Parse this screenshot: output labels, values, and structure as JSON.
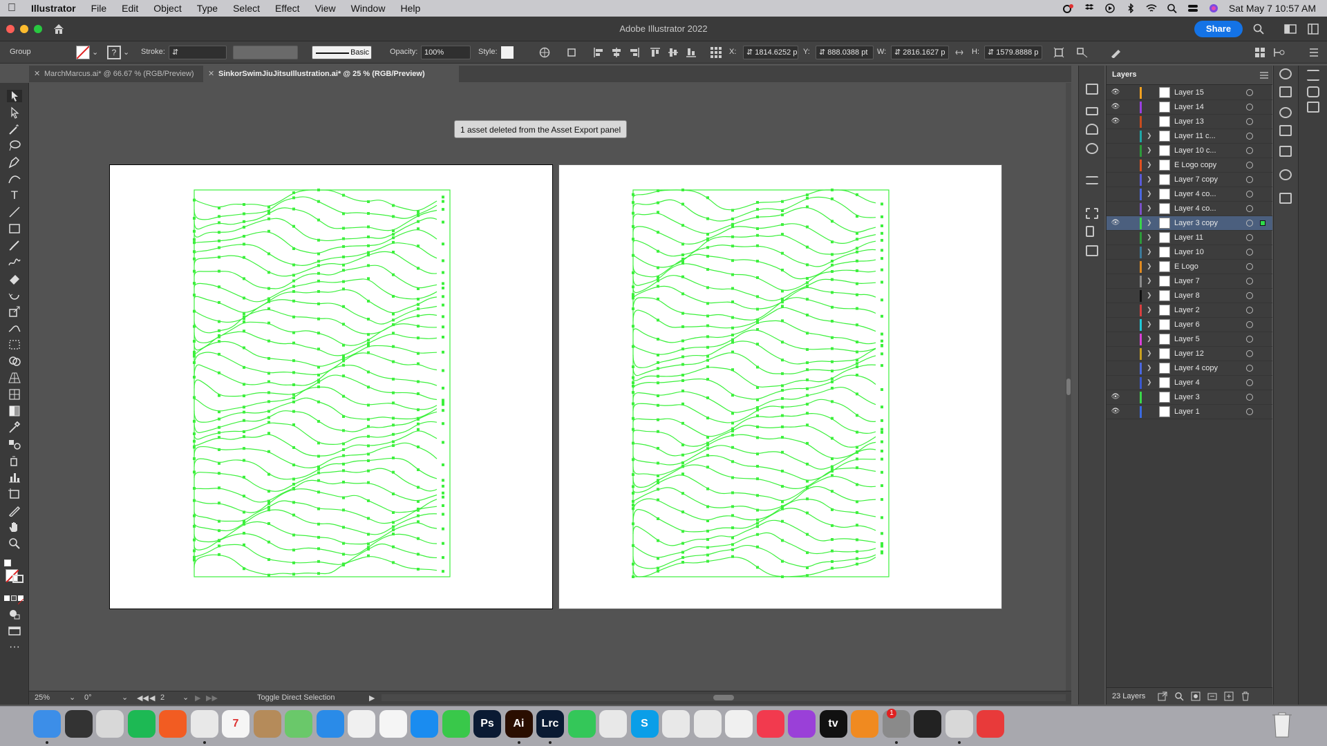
{
  "menubar": {
    "items": [
      "Illustrator",
      "File",
      "Edit",
      "Object",
      "Type",
      "Select",
      "Effect",
      "View",
      "Window",
      "Help"
    ],
    "date_time": "Sat May 7  10:57 AM"
  },
  "window": {
    "title": "Adobe Illustrator 2022",
    "share_label": "Share"
  },
  "control": {
    "selection_type": "Group",
    "stroke_label": "Stroke:",
    "brush_label": "Basic",
    "opacity_label": "Opacity:",
    "opacity_value": "100%",
    "style_label": "Style:",
    "x_label": "X:",
    "x_value": "1814.6252 p",
    "y_label": "Y:",
    "y_value": "888.0388 pt",
    "w_label": "W:",
    "w_value": "2816.1627 p",
    "h_label": "H:",
    "h_value": "1579.8888 p"
  },
  "tabs": [
    {
      "label": "MarchMarcus.ai* @ 66.67 % (RGB/Preview)",
      "active": false
    },
    {
      "label": "SinkorSwimJiuJitsuIllustration.ai* @ 25 % (RGB/Preview)",
      "active": true
    }
  ],
  "canvas": {
    "toast": "1 asset deleted from the Asset Export panel"
  },
  "status": {
    "zoom": "25%",
    "rotation": "0°",
    "artboard": "2",
    "tool_hint": "Toggle Direct Selection"
  },
  "layers_panel": {
    "title": "Layers",
    "count_label": "23 Layers",
    "layers": [
      {
        "name": "Layer 15",
        "color": "#f0a020",
        "visible": true,
        "expandable": false,
        "selected": false
      },
      {
        "name": "Layer 14",
        "color": "#9a3fe0",
        "visible": true,
        "expandable": false,
        "selected": false
      },
      {
        "name": "Layer 13",
        "color": "#c84c1e",
        "visible": true,
        "expandable": false,
        "selected": false
      },
      {
        "name": "Layer 11 c...",
        "color": "#1fa6a6",
        "visible": false,
        "expandable": true,
        "selected": false
      },
      {
        "name": "Layer 10 c...",
        "color": "#2d9a3a",
        "visible": false,
        "expandable": true,
        "selected": false
      },
      {
        "name": "E Logo copy",
        "color": "#e05020",
        "visible": false,
        "expandable": true,
        "selected": false
      },
      {
        "name": "Layer 7 copy",
        "color": "#5a5ad8",
        "visible": false,
        "expandable": true,
        "selected": false
      },
      {
        "name": "Layer 4 co...",
        "color": "#4b68e0",
        "visible": false,
        "expandable": true,
        "selected": false
      },
      {
        "name": "Layer 4 co...",
        "color": "#7a50c8",
        "visible": false,
        "expandable": true,
        "selected": false
      },
      {
        "name": "Layer 3 copy",
        "color": "#3ad64a",
        "visible": true,
        "expandable": true,
        "selected": true
      },
      {
        "name": "Layer 11",
        "color": "#2d9a3a",
        "visible": false,
        "expandable": true,
        "selected": false
      },
      {
        "name": "Layer 10",
        "color": "#3c7a9a",
        "visible": false,
        "expandable": true,
        "selected": false
      },
      {
        "name": "E Logo",
        "color": "#e08a20",
        "visible": false,
        "expandable": true,
        "selected": false
      },
      {
        "name": "Layer 7",
        "color": "#8a8a8a",
        "visible": false,
        "expandable": true,
        "selected": false
      },
      {
        "name": "Layer 8",
        "color": "#111111",
        "visible": false,
        "expandable": true,
        "selected": false
      },
      {
        "name": "Layer 2",
        "color": "#d84040",
        "visible": false,
        "expandable": true,
        "selected": false
      },
      {
        "name": "Layer 6",
        "color": "#20c8d8",
        "visible": false,
        "expandable": true,
        "selected": false
      },
      {
        "name": "Layer 5",
        "color": "#d840d8",
        "visible": false,
        "expandable": true,
        "selected": false
      },
      {
        "name": "Layer 12",
        "color": "#c8a020",
        "visible": false,
        "expandable": true,
        "selected": false
      },
      {
        "name": "Layer 4 copy",
        "color": "#4b68e0",
        "visible": false,
        "expandable": true,
        "selected": false
      },
      {
        "name": "Layer 4",
        "color": "#3a58d0",
        "visible": false,
        "expandable": true,
        "selected": false
      },
      {
        "name": "Layer 3",
        "color": "#3ad64a",
        "visible": true,
        "expandable": false,
        "selected": false
      },
      {
        "name": "Layer 1",
        "color": "#3a6ae0",
        "visible": true,
        "expandable": false,
        "selected": false
      }
    ]
  },
  "colors": {
    "accent": "#1473e6",
    "path_green": "#3cf03c"
  },
  "dock": [
    {
      "name": "finder",
      "color": "#3c8ee8",
      "glyph": ""
    },
    {
      "name": "siri",
      "color": "#333",
      "glyph": ""
    },
    {
      "name": "launchpad",
      "color": "#d8d8d8",
      "glyph": ""
    },
    {
      "name": "spotify",
      "color": "#1db954",
      "glyph": ""
    },
    {
      "name": "brave",
      "color": "#f25c22",
      "glyph": ""
    },
    {
      "name": "chrome",
      "color": "#e8e8e8",
      "glyph": ""
    },
    {
      "name": "calendar",
      "color": "#f5f5f5",
      "glyph": "7"
    },
    {
      "name": "contacts",
      "color": "#b58b5a",
      "glyph": ""
    },
    {
      "name": "maps",
      "color": "#6ac86a",
      "glyph": ""
    },
    {
      "name": "safari",
      "color": "#2a8be8",
      "glyph": ""
    },
    {
      "name": "photos",
      "color": "#f0f0f0",
      "glyph": ""
    },
    {
      "name": "reminders",
      "color": "#f5f5f5",
      "glyph": ""
    },
    {
      "name": "app-store",
      "color": "#1a8cf0",
      "glyph": ""
    },
    {
      "name": "messages",
      "color": "#39c84a",
      "glyph": ""
    },
    {
      "name": "photoshop",
      "color": "#0a1a33",
      "glyph": "Ps"
    },
    {
      "name": "illustrator",
      "color": "#2a0e00",
      "glyph": "Ai"
    },
    {
      "name": "lightroom-classic",
      "color": "#0a1a33",
      "glyph": "Lrc"
    },
    {
      "name": "facetime",
      "color": "#34c759",
      "glyph": ""
    },
    {
      "name": "script-editor",
      "color": "#e8e8e8",
      "glyph": ""
    },
    {
      "name": "skype",
      "color": "#0a9ee8",
      "glyph": "S"
    },
    {
      "name": "numbers",
      "color": "#e8e8e8",
      "glyph": ""
    },
    {
      "name": "keynote",
      "color": "#e8e8e8",
      "glyph": ""
    },
    {
      "name": "news",
      "color": "#f0f0f0",
      "glyph": ""
    },
    {
      "name": "music",
      "color": "#f23a4e",
      "glyph": ""
    },
    {
      "name": "podcasts",
      "color": "#9a40d8",
      "glyph": ""
    },
    {
      "name": "apple-tv",
      "color": "#111",
      "glyph": "tv"
    },
    {
      "name": "books",
      "color": "#f08a20",
      "glyph": ""
    },
    {
      "name": "system-preferences",
      "color": "#8a8a8a",
      "glyph": ""
    },
    {
      "name": "activity-monitor",
      "color": "#222",
      "glyph": ""
    },
    {
      "name": "preview",
      "color": "#d8d8d8",
      "glyph": ""
    },
    {
      "name": "creative-cloud",
      "color": "#e83a3a",
      "glyph": ""
    }
  ],
  "dock_badge": "1"
}
